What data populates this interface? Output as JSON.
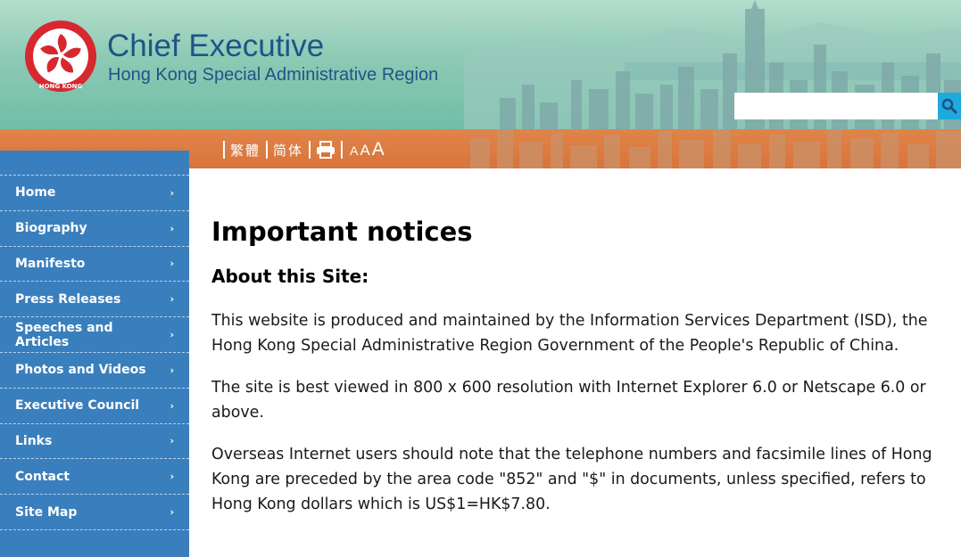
{
  "header": {
    "logo_text": "HONG KONG",
    "title": "Chief Executive",
    "subtitle": "Hong Kong Special Administrative Region",
    "search": {
      "placeholder": "",
      "value": "",
      "button_icon": "search-icon"
    }
  },
  "toolbar": {
    "traditional_chinese": "繁體",
    "simplified_chinese": "简体",
    "print_icon": "print-icon",
    "font_size_small": "A",
    "font_size_medium": "A",
    "font_size_large": "A"
  },
  "sidebar": {
    "items": [
      {
        "label": "Home"
      },
      {
        "label": "Biography"
      },
      {
        "label": "Manifesto"
      },
      {
        "label": "Press Releases"
      },
      {
        "label": "Speeches and Articles"
      },
      {
        "label": "Photos and Videos"
      },
      {
        "label": "Executive Council"
      },
      {
        "label": "Links"
      },
      {
        "label": "Contact"
      },
      {
        "label": "Site Map"
      }
    ],
    "chevron": "›"
  },
  "main": {
    "title": "Important notices",
    "section_title": "About this Site:",
    "paragraphs": [
      "This website is produced and maintained by the Information Services Department (ISD), the Hong Kong Special Administrative Region Government of the People's Republic of China.",
      "The site is best viewed in 800 x 600 resolution with Internet Explorer 6.0 or Netscape 6.0 or above.",
      "Overseas Internet users should note that the telephone numbers and facsimile lines of Hong Kong are preceded by the area code \"852\" and \"$\" in documents, unless specified, refers to Hong Kong dollars which is US$1=HK$7.80."
    ]
  },
  "colors": {
    "header_green": "#8ccab4",
    "title_blue": "#1f5487",
    "toolbar_orange": "#d9743b",
    "sidebar_blue": "#3a7fbd",
    "search_button": "#1eaadf",
    "emblem_red": "#d7282f"
  }
}
